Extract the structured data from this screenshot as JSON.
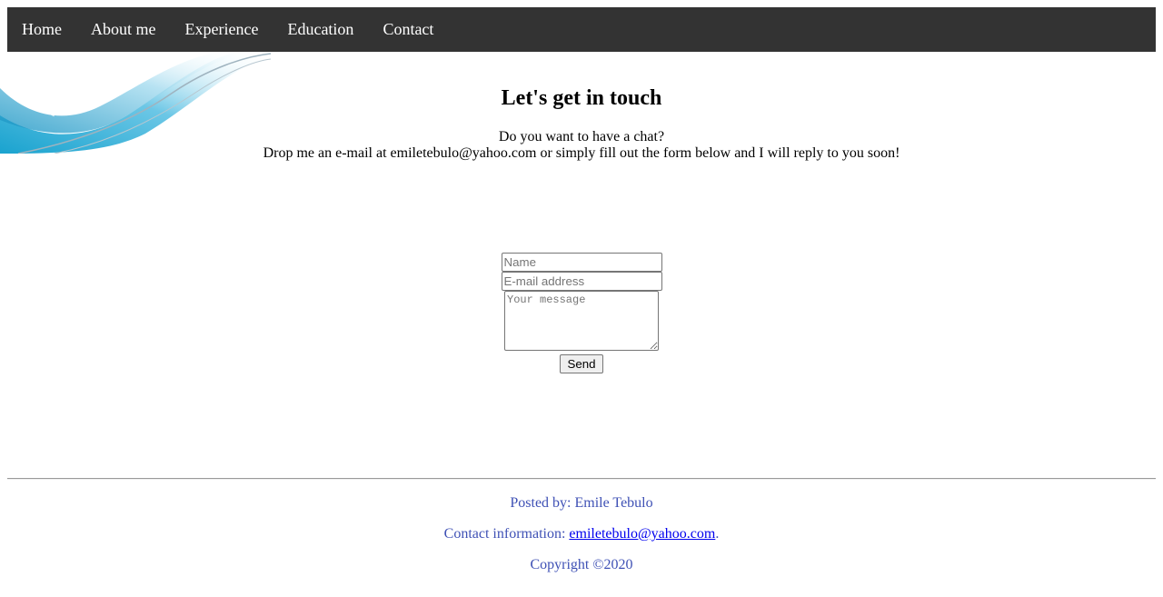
{
  "nav": {
    "items": [
      {
        "label": "Home"
      },
      {
        "label": "About me"
      },
      {
        "label": "Experience"
      },
      {
        "label": "Education"
      },
      {
        "label": "Contact"
      }
    ]
  },
  "main": {
    "title": "Let's get in touch",
    "intro_line1": "Do you want to have a chat?",
    "intro_line2": "Drop me an e-mail at emiletebulo@yahoo.com or simply fill out the form below and I will reply to you soon!"
  },
  "form": {
    "name_placeholder": "Name",
    "name_value": "",
    "email_placeholder": "E-mail address",
    "email_value": "",
    "message_placeholder": "Your message",
    "message_value": "",
    "send_label": "Send"
  },
  "footer": {
    "posted_by": "Posted by: Emile Tebulo",
    "contact_prefix": "Contact information: ",
    "contact_email": "emiletebulo@yahoo.com",
    "contact_suffix": ".",
    "copyright": "Copyright ©2020"
  },
  "colors": {
    "nav_background": "#333333",
    "nav_text": "#ffffff",
    "footer_text": "#3f51b5",
    "link": "#0000ee"
  },
  "icons": {
    "decoration": "blue-swoosh-banner"
  }
}
